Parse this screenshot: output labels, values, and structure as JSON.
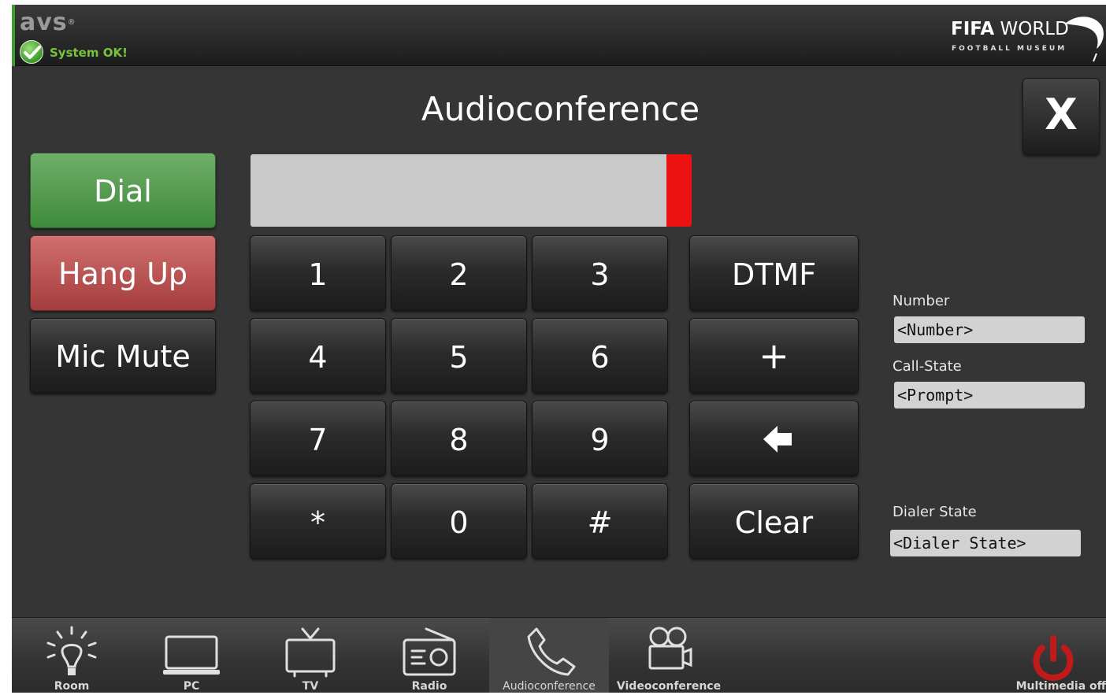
{
  "header": {
    "brand": "avs",
    "status_text": "System OK!",
    "partner_logo": {
      "bold": "FIFA",
      "rest": " WORLD",
      "subtitle": "FOOTBALL MUSEUM"
    }
  },
  "page_title": "Audioconference",
  "close_label": "X",
  "call_controls": {
    "dial": "Dial",
    "hang_up": "Hang Up",
    "mic_mute": "Mic Mute"
  },
  "number_display": {
    "value": ""
  },
  "keypad": [
    "1",
    "2",
    "3",
    "4",
    "5",
    "6",
    "7",
    "8",
    "9",
    "*",
    "0",
    "#"
  ],
  "side_keys": {
    "dtmf": "DTMF",
    "plus": "+",
    "backspace_icon": "backspace-arrow-icon",
    "clear": "Clear"
  },
  "info": {
    "number_label": "Number",
    "number_value": "<Number>",
    "call_state_label": "Call-State",
    "call_state_value": "<Prompt>",
    "dialer_state_label": "Dialer State",
    "dialer_state_value": "<Dialer State>"
  },
  "nav": [
    {
      "label": "Room",
      "icon": "lightbulb-icon",
      "active": false
    },
    {
      "label": "PC",
      "icon": "laptop-icon",
      "active": false
    },
    {
      "label": "TV",
      "icon": "tv-icon",
      "active": false
    },
    {
      "label": "Radio",
      "icon": "radio-icon",
      "active": false
    },
    {
      "label": "Audioconference",
      "icon": "phone-icon",
      "active": true
    },
    {
      "label": "Videoconference",
      "icon": "video-camera-icon",
      "active": false
    },
    {
      "label": "Multimedia off",
      "icon": "power-icon",
      "active": false
    }
  ],
  "colors": {
    "background": "#353535",
    "dial_green": "#4f9a4a",
    "hangup_red": "#bb5050",
    "cursor_red": "#ec1212",
    "status_green": "#78c43d",
    "power_red": "#c21a1a"
  }
}
